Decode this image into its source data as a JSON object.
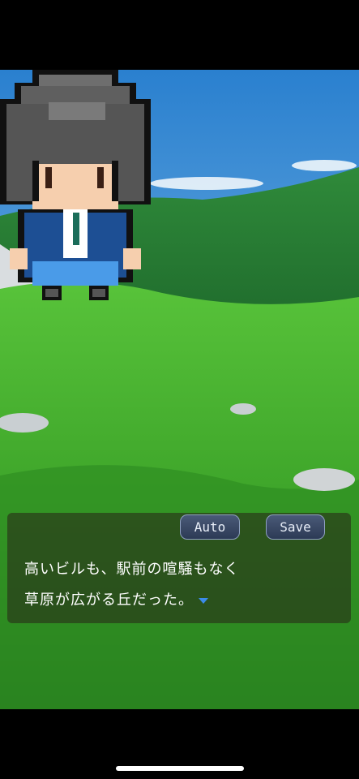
{
  "buttons": {
    "auto": "Auto",
    "save": "Save"
  },
  "dialog": {
    "line1": "高いビルも、駅前の喧騒もなく",
    "line2": "草原が広がる丘だった。"
  },
  "colors": {
    "sky": "#3d8fd8",
    "grass": "#3fa82a",
    "hair": "#555555",
    "jacket": "#1d4f94"
  }
}
